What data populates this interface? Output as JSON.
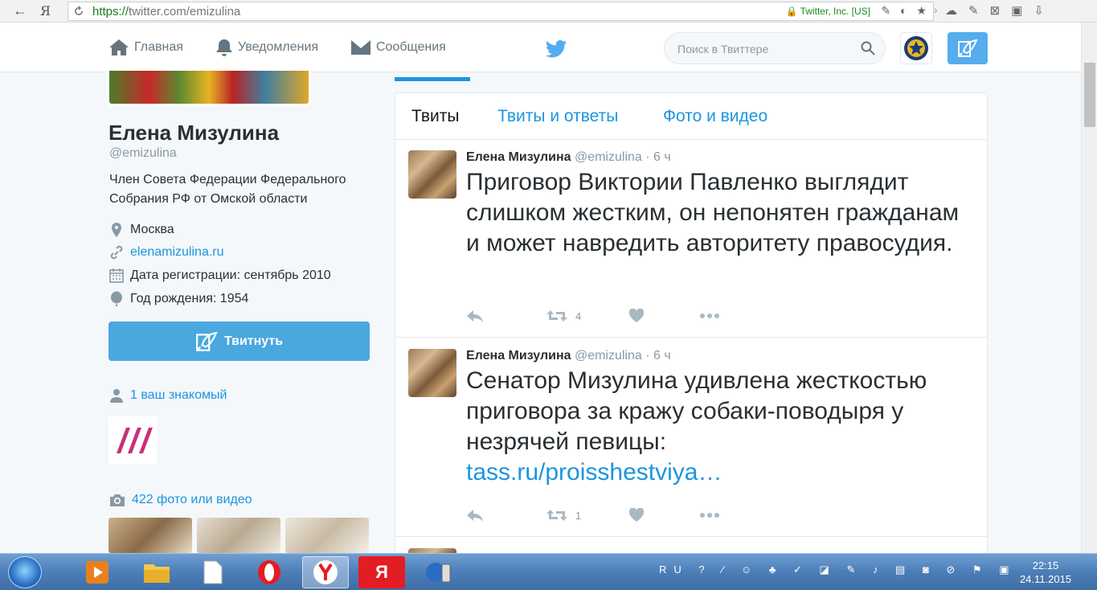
{
  "browser": {
    "back_icon": "←",
    "yandex_button": "Я",
    "url_scheme": "https://",
    "url_host": "twitter.com/",
    "url_path": "emizulina",
    "secure_label": "Twitter, Inc. [US]"
  },
  "nav": {
    "home": "Главная",
    "notifications": "Уведомления",
    "messages": "Сообщения",
    "search_placeholder": "Поиск в Твиттере"
  },
  "profile": {
    "name": "Елена Мизулина",
    "handle": "@emizulina",
    "bio": "Член Совета Федерации Федерального Собрания РФ от Омской области",
    "location": "Москва",
    "website": "elenamizulina.ru",
    "joined": "Дата регистрации: сентябрь 2010",
    "birth": "Год рождения: 1954",
    "tweet_button": "Твитнуть",
    "followers_you_know": "1 ваш знакомый",
    "photos_videos": "422 фото или видео"
  },
  "tabs": [
    {
      "label": "Твиты",
      "active": true
    },
    {
      "label": "Твиты и ответы",
      "active": false
    },
    {
      "label": "Фото и видео",
      "active": false
    }
  ],
  "tweets": [
    {
      "name": "Елена Мизулина",
      "handle": "@emizulina",
      "time": "· 6 ч",
      "text": "Приговор Виктории Павленко выглядит слишком жестким, он непонятен гражданам и может навредить авторитету правосудия.",
      "link": "",
      "retweets": "4"
    },
    {
      "name": "Елена Мизулина",
      "handle": "@emizulina",
      "time": "· 6 ч",
      "text": "Сенатор Мизулина удивлена жесткостью приговора за кражу собаки-поводыря у незрячей певицы:",
      "link": "tass.ru/proisshestviya…",
      "retweets": "1"
    }
  ],
  "taskbar": {
    "language": "RU",
    "time": "22:15",
    "date": "24.11.2015",
    "yandex_app": "Я"
  },
  "colors": {
    "twitter_blue": "#1b95e0",
    "tweet_button": "#4aa8de",
    "compose_button": "#55acee"
  }
}
